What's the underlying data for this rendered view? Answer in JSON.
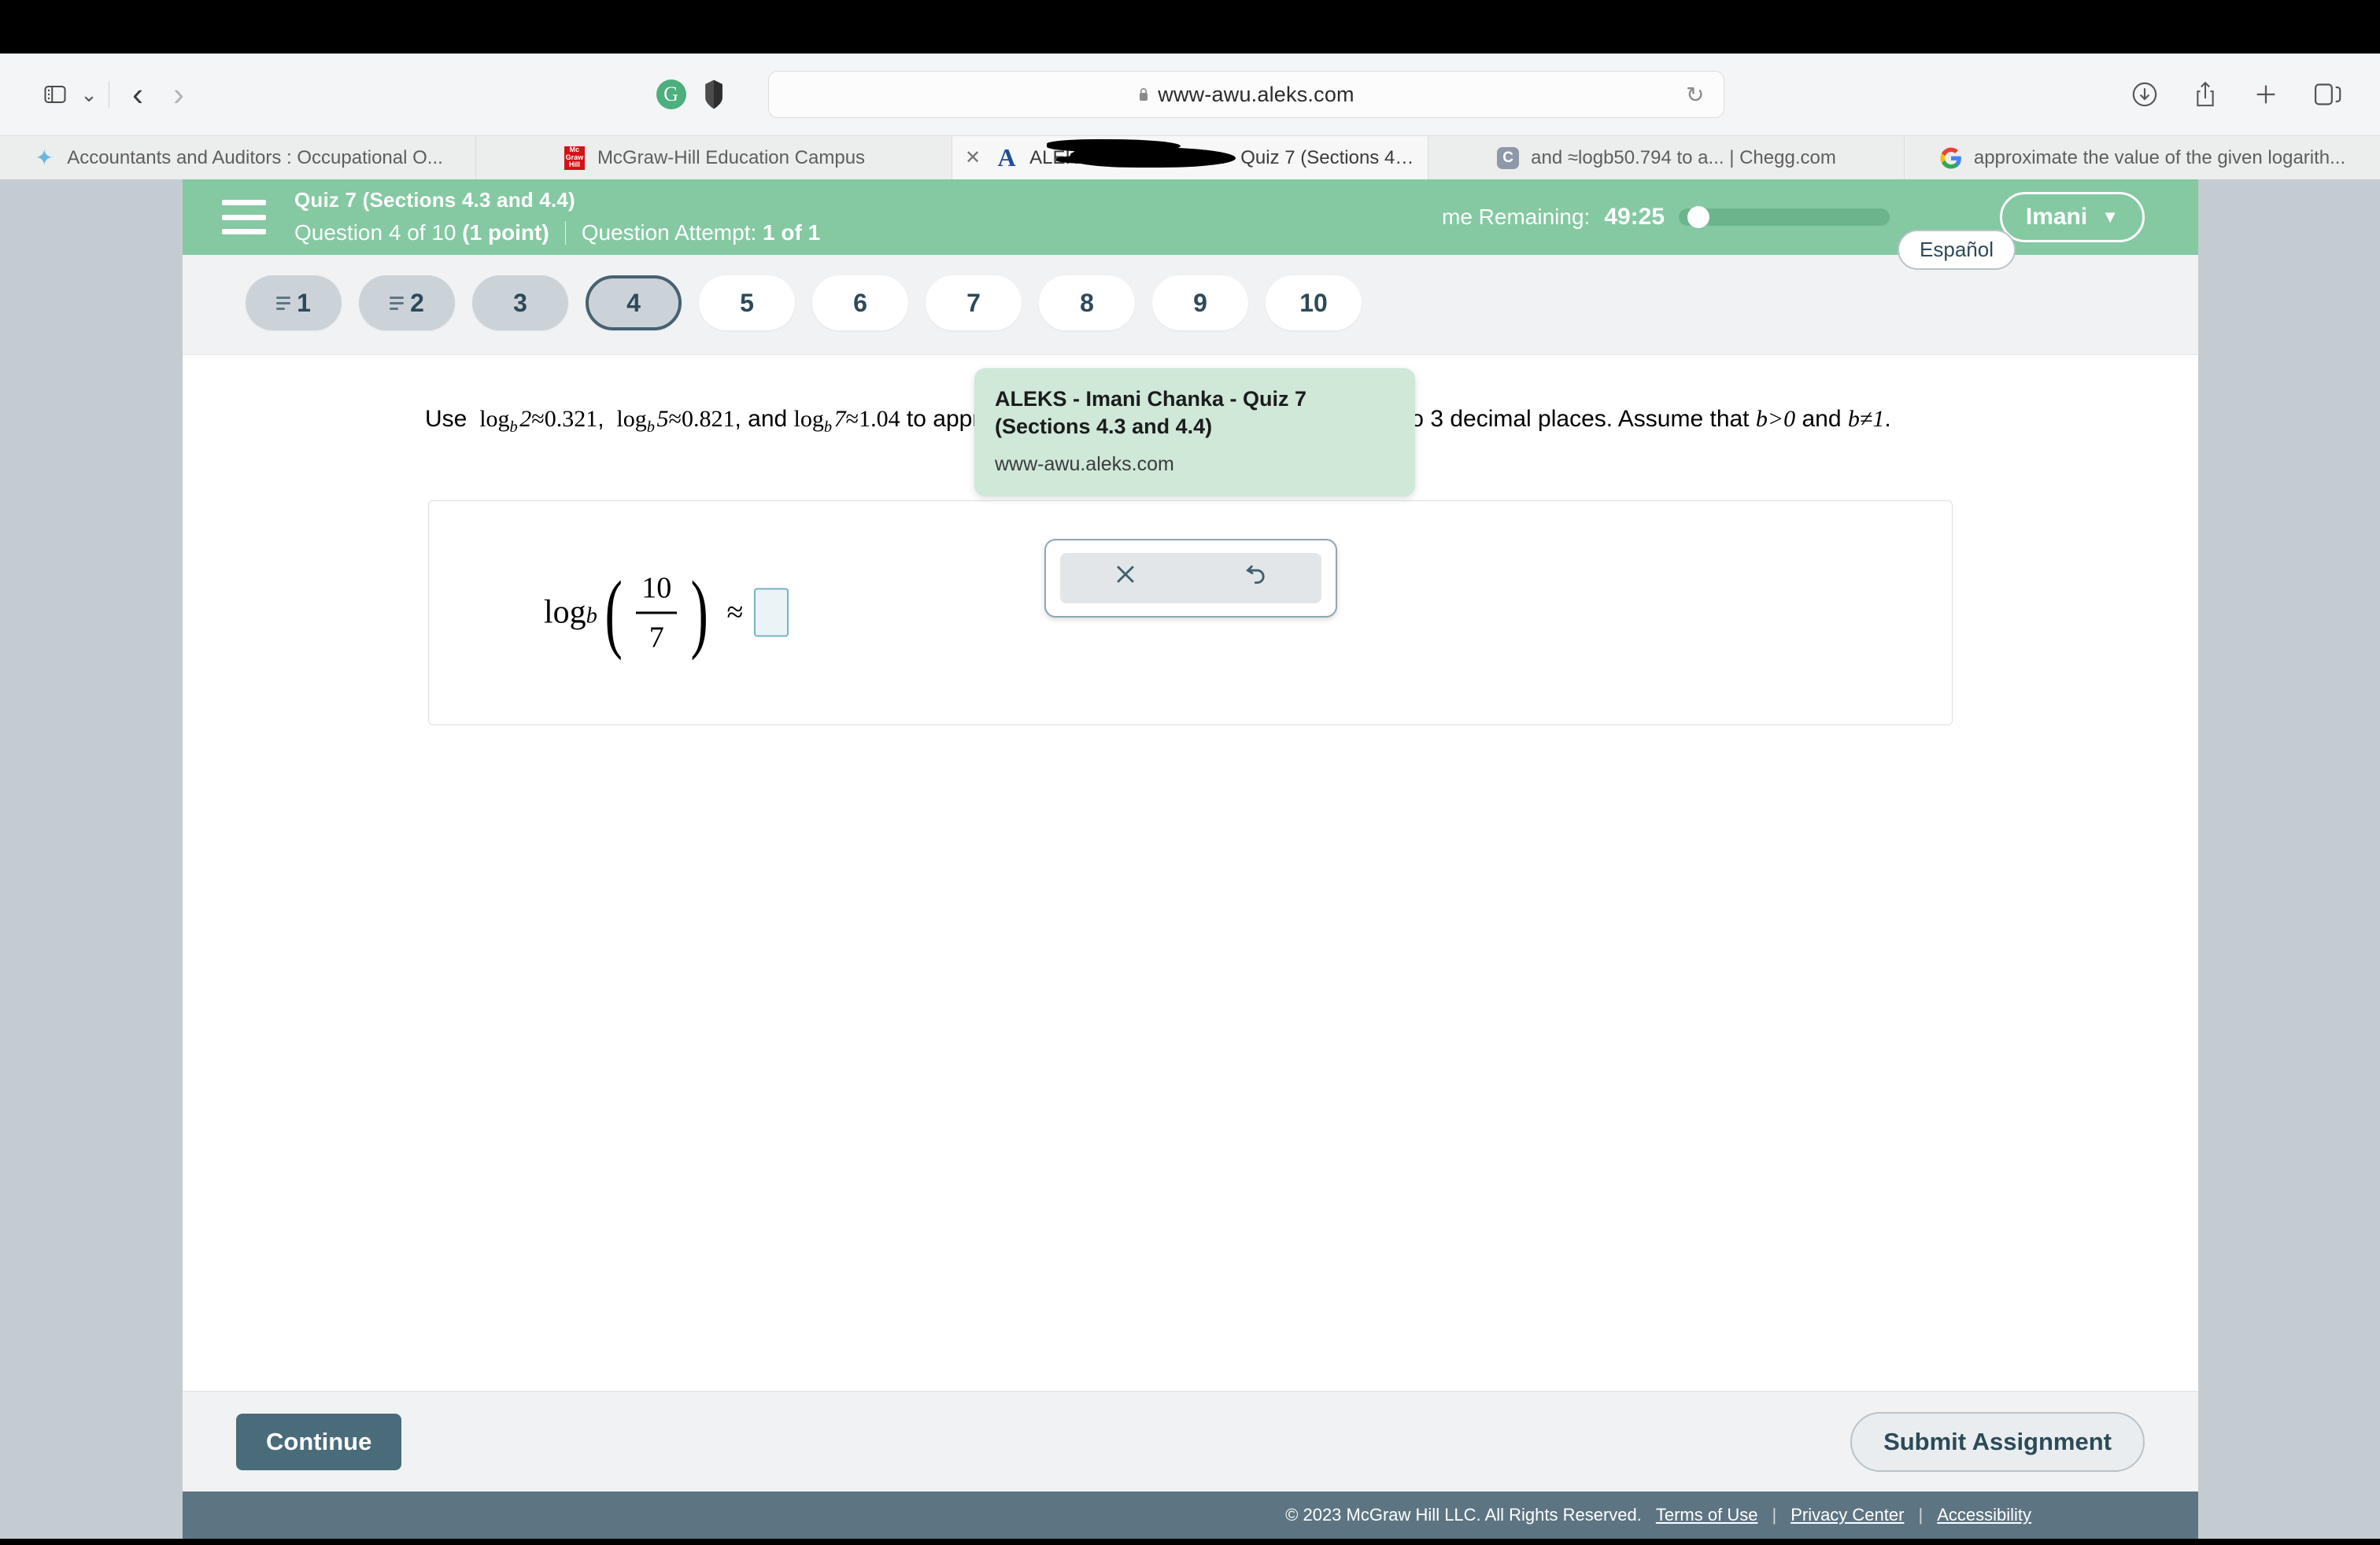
{
  "browser": {
    "url": "www-awu.aleks.com",
    "icons": {
      "sidebar": "sidebar-icon",
      "tabgroup_chevron": "chevron-down-icon",
      "back": "back-arrow-icon",
      "forward": "forward-arrow-icon",
      "grammarly": "grammarly-icon",
      "shield": "shield-extension-icon",
      "lock": "lock-icon",
      "reload": "reload-icon",
      "downloads": "downloads-icon",
      "share": "share-icon",
      "new_tab": "plus-icon",
      "tab_overview": "tab-overview-icon"
    },
    "tabs": [
      {
        "label": "Accountants and Auditors : Occupational O...",
        "favicon": "bls-star-icon",
        "active": false,
        "closable": false
      },
      {
        "label": "McGraw-Hill Education Campus",
        "favicon": "mcgraw-hill-icon",
        "active": false,
        "closable": false
      },
      {
        "label": "ALEKS - Imani Chanka - Quiz 7 (Sections 4....",
        "favicon": "aleks-a-icon",
        "active": true,
        "closable": true
      },
      {
        "label": "and ≈logb50.794 to a... | Chegg.com",
        "favicon": "chegg-icon",
        "active": false,
        "closable": false
      },
      {
        "label": "approximate the value of the given logarith...",
        "favicon": "google-g-icon",
        "active": false,
        "closable": false
      }
    ]
  },
  "tooltip": {
    "title": "ALEKS - Imani Chanka - Quiz 7 (Sections 4.3 and 4.4)",
    "url": "www-awu.aleks.com"
  },
  "header": {
    "menu_icon": "hamburger-menu-icon",
    "quiz_title": "Quiz 7 (Sections 4.3 and 4.4)",
    "question_label": "Question 4 of 10",
    "points": "(1 point)",
    "attempt_label": "Question Attempt:",
    "attempt_value": "1 of 1",
    "timer_label": "me Remaining:",
    "timer_value": "49:25",
    "timer_progress_percent": 4,
    "user_name": "Imani",
    "user_caret": "chevron-down-icon",
    "accent_green": "#84c9a2"
  },
  "nav": {
    "espanol_label": "Español",
    "pills": [
      {
        "label": "1",
        "state": "answered",
        "has_lines_icon": true
      },
      {
        "label": "2",
        "state": "answered",
        "has_lines_icon": true
      },
      {
        "label": "3",
        "state": "answered",
        "has_lines_icon": false
      },
      {
        "label": "4",
        "state": "current",
        "has_lines_icon": false
      },
      {
        "label": "5",
        "state": "unanswered",
        "has_lines_icon": false
      },
      {
        "label": "6",
        "state": "unanswered",
        "has_lines_icon": false
      },
      {
        "label": "7",
        "state": "unanswered",
        "has_lines_icon": false
      },
      {
        "label": "8",
        "state": "unanswered",
        "has_lines_icon": false
      },
      {
        "label": "9",
        "state": "unanswered",
        "has_lines_icon": false
      },
      {
        "label": "10",
        "state": "unanswered",
        "has_lines_icon": false
      }
    ]
  },
  "question": {
    "prefix": "Use",
    "term1": "log",
    "term1_sub": "b",
    "term1_arg": "2",
    "term1_approx": "≈0.321",
    "term2_arg": "5",
    "term2_approx": "≈0.821",
    "term3_arg": "7",
    "term3_approx": "≈1.04",
    "middle": "to approximate the value of the given logarithm to 3 decimal places. Assume that",
    "cond1": "b>0",
    "conj": "and",
    "cond2": "b≠1",
    "period": "."
  },
  "answer": {
    "log_label": "log",
    "log_sub": "b",
    "numerator": "10",
    "denominator": "7",
    "approx_symbol": "≈",
    "input_value": "",
    "input_placeholder": ""
  },
  "mini_toolbar": {
    "clear_icon": "x-clear-icon",
    "undo_icon": "undo-icon"
  },
  "footer": {
    "continue_label": "Continue",
    "submit_label": "Submit Assignment",
    "copyright": "© 2023 McGraw Hill LLC. All Rights Reserved.",
    "links": [
      "Terms of Use",
      "Privacy Center",
      "Accessibility"
    ]
  }
}
